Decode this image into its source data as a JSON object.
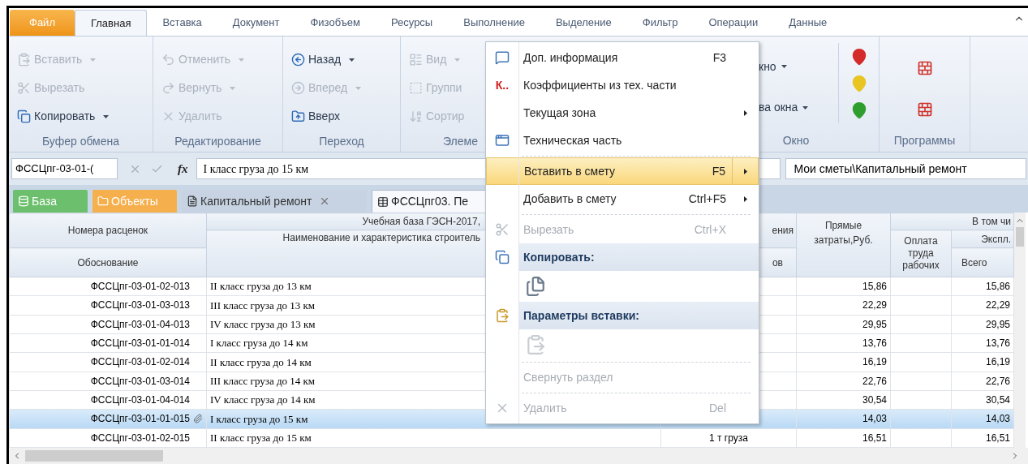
{
  "ribbon_tabs": [
    {
      "label": "Файл",
      "kind": "file",
      "selected": false
    },
    {
      "label": "Главная",
      "kind": "tab",
      "selected": true
    },
    {
      "label": "Вставка",
      "kind": "tab",
      "selected": false
    },
    {
      "label": "Документ",
      "kind": "tab",
      "selected": false
    },
    {
      "label": "Физобъем",
      "kind": "tab",
      "selected": false
    },
    {
      "label": "Ресурсы",
      "kind": "tab",
      "selected": false
    },
    {
      "label": "Выполнение",
      "kind": "tab",
      "selected": false
    },
    {
      "label": "Выделение",
      "kind": "tab",
      "selected": false
    },
    {
      "label": "Фильтр",
      "kind": "tab",
      "selected": false
    },
    {
      "label": "Операции",
      "kind": "tab",
      "selected": false
    },
    {
      "label": "Данные",
      "kind": "tab",
      "selected": false
    }
  ],
  "ribbon_groups": [
    {
      "label": "Буфер обмена",
      "items": [
        {
          "label": "Вставить",
          "dropdown": true,
          "disabled": true
        },
        {
          "label": "Вырезать",
          "dropdown": false,
          "disabled": true
        },
        {
          "label": "Копировать",
          "dropdown": true,
          "disabled": false
        }
      ]
    },
    {
      "label": "Редактирование",
      "items": [
        {
          "label": "Отменить",
          "dropdown": true,
          "disabled": true
        },
        {
          "label": "Вернуть",
          "dropdown": true,
          "disabled": true
        },
        {
          "label": "Удалить",
          "dropdown": false,
          "disabled": true
        }
      ]
    },
    {
      "label": "Переход",
      "items": [
        {
          "label": "Назад",
          "dropdown": true,
          "disabled": false
        },
        {
          "label": "Вперед",
          "dropdown": true,
          "disabled": true
        },
        {
          "label": "Вверх",
          "dropdown": false,
          "disabled": false
        }
      ]
    },
    {
      "label": "Элеме",
      "items": [
        {
          "label": "Вид",
          "dropdown": true,
          "disabled": true
        },
        {
          "label": "Группи",
          "dropdown": false,
          "disabled": true
        },
        {
          "label": "Сортир",
          "dropdown": false,
          "disabled": true
        }
      ]
    }
  ],
  "window_group": {
    "label": "Окно",
    "items": [
      {
        "label": "кно",
        "dropdown": true
      },
      {
        "label": "ва окна",
        "dropdown": true
      }
    ],
    "pins": [
      {
        "color": "#d42a2a"
      },
      {
        "color": "#e8c521"
      },
      {
        "color": "#2f9e2f"
      }
    ]
  },
  "programs_group": {
    "label": "Программы"
  },
  "formula_bar": {
    "name_box": "ФССЦпг-03-01-(",
    "function_sign": "fx",
    "value": "I класс груза до 15 км",
    "path": "Мои сметы\\Капитальный ремонт"
  },
  "doc_tabs": [
    {
      "label": "База",
      "kind": "base",
      "selected": false,
      "closable": false
    },
    {
      "label": "Объекты",
      "kind": "objects",
      "selected": false,
      "closable": false
    },
    {
      "label": "Капитальный ремонт",
      "kind": "doc",
      "selected": false,
      "closable": true
    },
    {
      "label": "ФССЦпг03. Пе",
      "kind": "table",
      "selected": true,
      "closable": false
    }
  ],
  "table": {
    "header": {
      "col1_group": "Номера расценок",
      "col1": "Обоснование",
      "col2_group": "Учебная база ГЭСН-2017,",
      "col2": "Наименование и характеристика строитель",
      "col3_group": "ения",
      "col3": "ов",
      "col4": "Прямые затраты,Руб.",
      "col56_group": "В том чи",
      "col5": "Оплата труда рабочих",
      "col6_group": "Экспл.",
      "col6": "Всего"
    },
    "rows": [
      {
        "code": "ФССЦпг-03-01-02-013",
        "name": "II класс груза до 13 км",
        "direct": "15,86",
        "total": "15,86",
        "selected": false,
        "attachment": false
      },
      {
        "code": "ФССЦпг-03-01-03-013",
        "name": "III класс груза до 13 км",
        "direct": "22,29",
        "total": "22,29",
        "selected": false,
        "attachment": false
      },
      {
        "code": "ФССЦпг-03-01-04-013",
        "name": "IV класс груза до 13 км",
        "direct": "29,95",
        "total": "29,95",
        "selected": false,
        "attachment": false
      },
      {
        "code": "ФССЦпг-03-01-01-014",
        "name": "I класс груза до 14 км",
        "direct": "13,76",
        "total": "13,76",
        "selected": false,
        "attachment": false
      },
      {
        "code": "ФССЦпг-03-01-02-014",
        "name": "II класс груза до 14 км",
        "direct": "16,19",
        "total": "16,19",
        "selected": false,
        "attachment": false
      },
      {
        "code": "ФССЦпг-03-01-03-014",
        "name": "III класс груза до 14 км",
        "direct": "22,76",
        "total": "22,76",
        "selected": false,
        "attachment": false
      },
      {
        "code": "ФССЦпг-03-01-04-014",
        "name": "IV класс груза до 14 км",
        "direct": "30,54",
        "total": "30,54",
        "selected": false,
        "attachment": false
      },
      {
        "code": "ФССЦпг-03-01-01-015",
        "name": "I класс груза до 15 км",
        "direct": "14,03",
        "total": "14,03",
        "selected": true,
        "attachment": true
      },
      {
        "code": "ФССЦпг-03-01-02-015",
        "name": "II класс груза до 15 км",
        "unit": "1 т груза",
        "direct": "16,51",
        "total": "16,51",
        "selected": false,
        "attachment": false
      }
    ]
  },
  "context_menu": [
    {
      "kind": "item",
      "label": "Доп. информация",
      "shortcut": "F3",
      "submenu": false,
      "disabled": false,
      "selected": false
    },
    {
      "kind": "item",
      "icon_text": "К..",
      "label": "Коэффициенты из тех. части",
      "submenu": false,
      "disabled": false,
      "selected": false
    },
    {
      "kind": "item",
      "label": "Текущая зона",
      "submenu": true,
      "disabled": false,
      "selected": false
    },
    {
      "kind": "item",
      "label": "Техническая часть",
      "submenu": false,
      "disabled": false,
      "selected": false
    },
    {
      "kind": "separator"
    },
    {
      "kind": "item",
      "label": "Вставить в смету",
      "shortcut": "F5",
      "submenu": true,
      "disabled": false,
      "selected": true
    },
    {
      "kind": "item",
      "label": "Добавить в смету",
      "shortcut": "Ctrl+F5",
      "submenu": true,
      "disabled": false,
      "selected": false
    },
    {
      "kind": "separator"
    },
    {
      "kind": "item",
      "label": "Вырезать",
      "shortcut": "Ctrl+X",
      "submenu": false,
      "disabled": true,
      "selected": false
    },
    {
      "kind": "header",
      "label": "Копировать:"
    },
    {
      "kind": "icons",
      "disabled": false
    },
    {
      "kind": "header",
      "label": "Параметры вставки:"
    },
    {
      "kind": "icons",
      "disabled": true
    },
    {
      "kind": "separator"
    },
    {
      "kind": "item",
      "label": "Свернуть раздел",
      "submenu": false,
      "disabled": true,
      "selected": false
    },
    {
      "kind": "separator"
    },
    {
      "kind": "item",
      "label": "Удалить",
      "shortcut": "Del",
      "submenu": false,
      "disabled": true,
      "selected": false
    }
  ]
}
